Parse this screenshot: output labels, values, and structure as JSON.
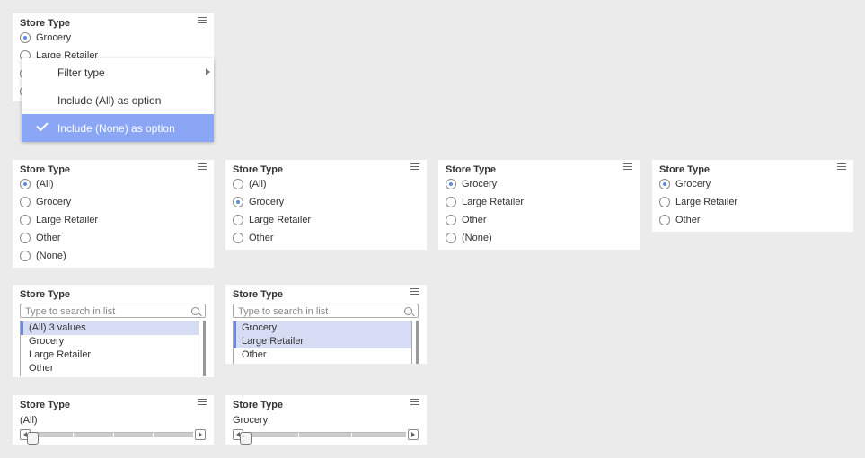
{
  "card_title": "Store Type",
  "top_card": {
    "items": [
      {
        "label": "Grocery",
        "selected": true
      },
      {
        "label": "Large Retailer",
        "selected": false
      }
    ]
  },
  "context_menu": {
    "items": [
      {
        "label": "Filter type",
        "has_submenu": true,
        "checked": false
      },
      {
        "label": "Include (All) as option",
        "checked": false
      },
      {
        "label": "Include (None) as option",
        "checked": true
      }
    ]
  },
  "radio_cards": [
    {
      "items": [
        {
          "label": "(All)",
          "selected": true
        },
        {
          "label": "Grocery",
          "selected": false
        },
        {
          "label": "Large Retailer",
          "selected": false
        },
        {
          "label": "Other",
          "selected": false
        },
        {
          "label": "(None)",
          "selected": false
        }
      ]
    },
    {
      "items": [
        {
          "label": "(All)",
          "selected": false
        },
        {
          "label": "Grocery",
          "selected": true
        },
        {
          "label": "Large Retailer",
          "selected": false
        },
        {
          "label": "Other",
          "selected": false
        }
      ]
    },
    {
      "items": [
        {
          "label": "Grocery",
          "selected": true
        },
        {
          "label": "Large Retailer",
          "selected": false
        },
        {
          "label": "Other",
          "selected": false
        },
        {
          "label": "(None)",
          "selected": false
        }
      ]
    },
    {
      "items": [
        {
          "label": "Grocery",
          "selected": true
        },
        {
          "label": "Large Retailer",
          "selected": false
        },
        {
          "label": "Other",
          "selected": false
        }
      ]
    }
  ],
  "list_cards": [
    {
      "search_placeholder": "Type to search in list",
      "items": [
        {
          "label": "(All) 3 values",
          "selected": true
        },
        {
          "label": "Grocery",
          "selected": false
        },
        {
          "label": "Large Retailer",
          "selected": false
        },
        {
          "label": "Other",
          "selected": false
        }
      ]
    },
    {
      "search_placeholder": "Type to search in list",
      "items": [
        {
          "label": "Grocery",
          "selected": true
        },
        {
          "label": "Large Retailer",
          "selected": true
        },
        {
          "label": "Other",
          "selected": false
        }
      ]
    }
  ],
  "slider_cards": [
    {
      "value": "(All)"
    },
    {
      "value": "Grocery"
    }
  ],
  "colors": {
    "accent": "#5a8ee0",
    "menu_highlight": "#8aa6f5",
    "list_selected": "#d7dcf5",
    "background": "#ebebeb"
  },
  "icons": {
    "menu": "hamburger-menu-icon",
    "search": "search-icon",
    "check": "checkmark-icon",
    "submenu": "triangle-right-icon",
    "prev": "triangle-left-icon",
    "next": "triangle-right-icon"
  }
}
